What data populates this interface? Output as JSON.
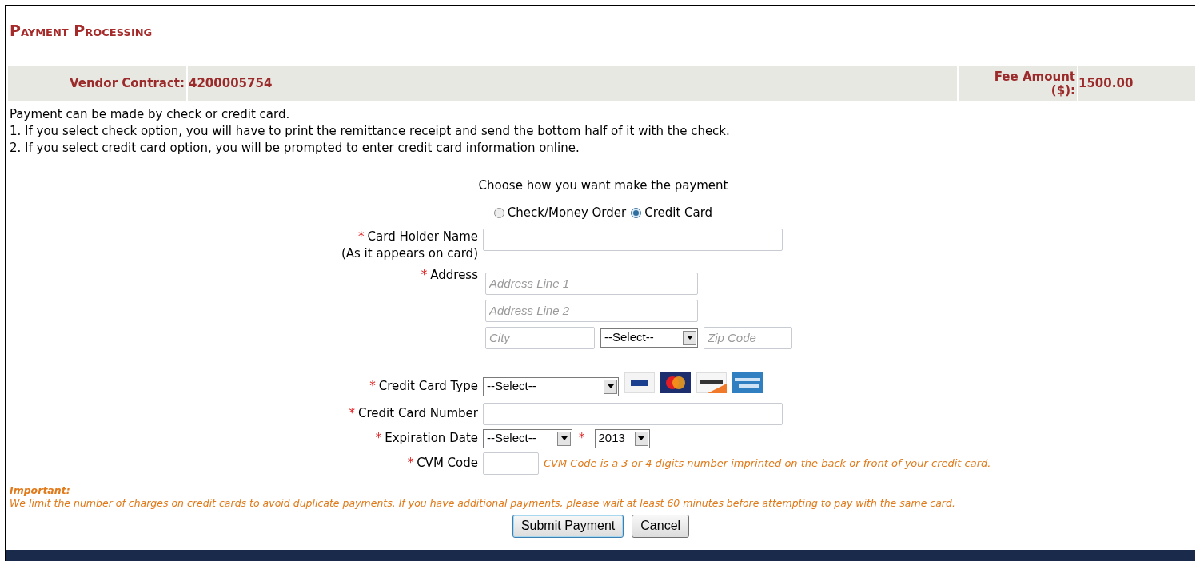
{
  "page_title": "Payment Processing",
  "summary": {
    "vendor_label": "Vendor Contract:",
    "vendor_value": "4200005754",
    "fee_label": "Fee Amount ($):",
    "fee_value": "1500.00"
  },
  "intro": [
    "Payment can be made by check or credit card.",
    "1. If you select check option, you will have to print the remittance receipt and send the bottom half of it with the check.",
    "2. If you select credit card option, you will be prompted to enter credit card information online."
  ],
  "payment_prompt": "Choose how you want make the payment",
  "payment_methods": [
    {
      "label": "Check/Money Order",
      "selected": false
    },
    {
      "label": "Credit Card",
      "selected": true
    }
  ],
  "card_holder": {
    "label": "Card Holder Name",
    "sublabel": "(As it appears on card)",
    "required_mark": "*"
  },
  "address": {
    "label": "Address",
    "required_mark": "*",
    "line1_placeholder": "Address Line 1",
    "line2_placeholder": "Address Line 2",
    "city_placeholder": "City",
    "state_value": "--Select--",
    "zip_placeholder": "Zip Code"
  },
  "card_type": {
    "label": "Credit Card Type",
    "required_mark": "*",
    "value": "--Select--"
  },
  "card_number": {
    "label": "Credit Card Number",
    "required_mark": "*"
  },
  "expiration": {
    "label": "Expiration Date",
    "required_mark": "*",
    "month_value": "--Select--",
    "year_required_mark": "*",
    "year_value": "2013"
  },
  "cvm": {
    "label": "CVM Code",
    "required_mark": "*",
    "hint": "CVM Code is a 3 or 4 digits number imprinted on the back or front of your credit card."
  },
  "notice": {
    "title": "Important:",
    "text": "We limit the number of charges on credit cards to avoid duplicate payments. If you have additional payments, please wait at least 60 minutes before attempting to pay with the same card."
  },
  "buttons": [
    {
      "label": "Submit Payment",
      "default": true
    },
    {
      "label": "Cancel",
      "default": false
    }
  ]
}
